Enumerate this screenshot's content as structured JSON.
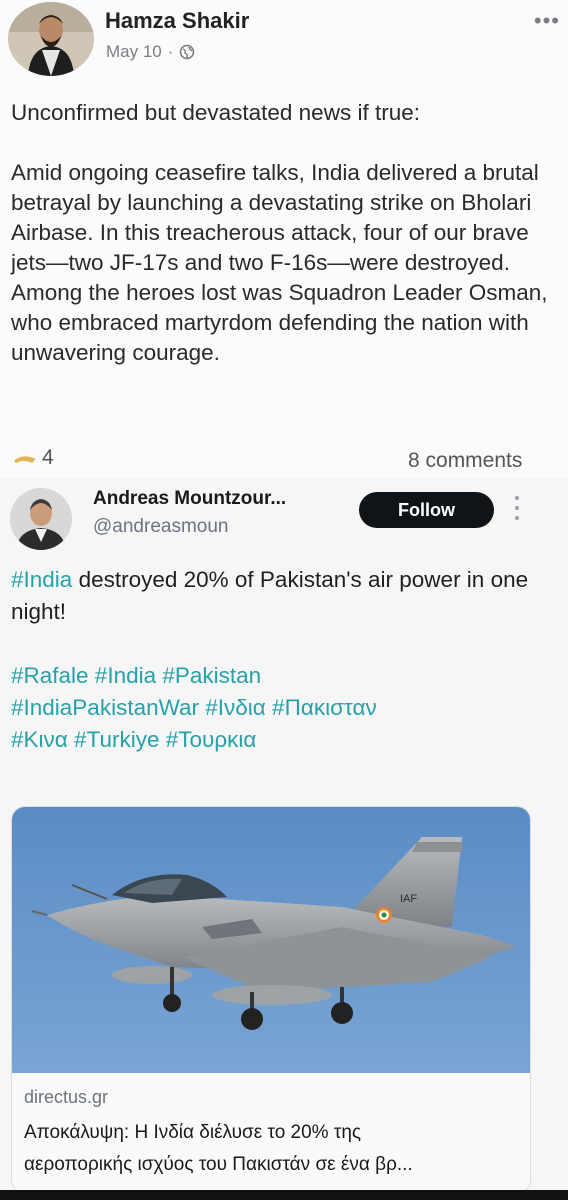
{
  "fb_post": {
    "author": "Hamza Shakir",
    "date": "May 10",
    "separator": "·",
    "audience_icon": "globe-icon",
    "more_icon": "•••",
    "paragraphs": [
      "Unconfirmed but devastated news if true:",
      "Amid ongoing ceasefire talks, India delivered a brutal betrayal by launching a devastating strike on Bholari Airbase. In this treacherous attack, four of our brave jets—two JF-17s and two F-16s—were destroyed. Among the heroes lost was Squadron Leader Osman, who embraced martyrdom defending the nation with unwavering courage."
    ],
    "reaction_count": "4",
    "comments": "8 comments"
  },
  "tweet": {
    "name": "Andreas Mountzour...",
    "handle": "@andreasmoun",
    "follow_label": "Follow",
    "line1_tag": "#India",
    "line1_rest": " destroyed 20% of Pakistan's air power in one night!",
    "hashtag_lines": [
      "#Rafale #India #Pakistan",
      "#IndiaPakistanWar #Ινδια #Πακισταν",
      "#Κινα #Turkiye #Τουρκια"
    ],
    "card": {
      "fuselage_mark": "IAF",
      "domain": "directus.gr",
      "title_line1": "Αποκάλυψη: Η Ινδία διέλυσε το 20% της",
      "title_line2": "αεροπορικής ισχύος του Πακιστάν σε ένα βρ..."
    }
  },
  "colors": {
    "hashtag": "#27a0a8",
    "follow_bg": "#0f1419",
    "sky": "#5f8fc4"
  }
}
